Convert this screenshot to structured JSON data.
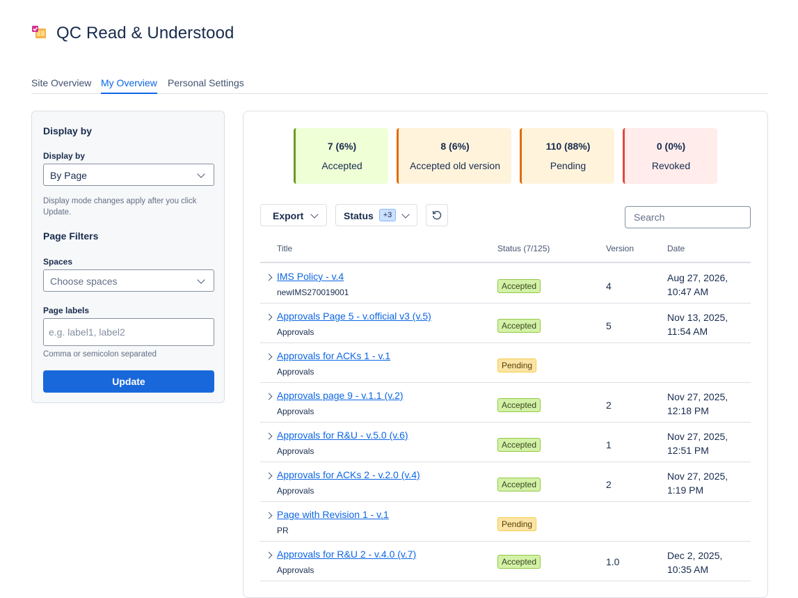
{
  "app": {
    "title": "QC Read & Understood",
    "icon": "book-check-icon"
  },
  "tabs": [
    {
      "label": "Site Overview",
      "active": false
    },
    {
      "label": "My Overview",
      "active": true
    },
    {
      "label": "Personal Settings",
      "active": false
    }
  ],
  "sidebar": {
    "heading": "Display by",
    "display_by": {
      "label": "Display by",
      "value": "By Page",
      "help": "Display mode changes apply after you click Update."
    },
    "page_filters_heading": "Page Filters",
    "spaces": {
      "label": "Spaces",
      "placeholder": "Choose spaces"
    },
    "page_labels": {
      "label": "Page labels",
      "placeholder": "e.g. label1, label2",
      "help": "Comma or semicolon separated"
    },
    "update_label": "Update"
  },
  "stats": [
    {
      "value": "7 (6%)",
      "label": "Accepted",
      "bg": "#efffd6",
      "accent": "#6a9a23"
    },
    {
      "value": "8 (6%)",
      "label": "Accepted old version",
      "bg": "#fff3dc",
      "accent": "#e06c00"
    },
    {
      "value": "110 (88%)",
      "label": "Pending",
      "bg": "#fff3dc",
      "accent": "#e06c00"
    },
    {
      "value": "0 (0%)",
      "label": "Revoked",
      "bg": "#ffeceb",
      "accent": "#e2483d"
    }
  ],
  "toolbar": {
    "export_label": "Export",
    "status_label": "Status",
    "status_count": "+3",
    "search_placeholder": "Search"
  },
  "table": {
    "columns": [
      "Title",
      "Status (7/125)",
      "Version",
      "Date"
    ],
    "rows": [
      {
        "title": "IMS Policy - v.4",
        "space": "newIMS270019001",
        "status": "Accepted",
        "version": "4",
        "date": "Aug 27, 2026,\n10:47 AM"
      },
      {
        "title": "Approvals Page 5 - v.official v3 (v.5)",
        "space": "Approvals",
        "status": "Accepted",
        "version": "5",
        "date": "Nov 13, 2025,\n11:54 AM"
      },
      {
        "title": "Approvals for ACKs 1 - v.1",
        "space": "Approvals",
        "status": "Pending",
        "version": "",
        "date": ""
      },
      {
        "title": "Approvals page 9 - v.1.1 (v.2)",
        "space": "Approvals",
        "status": "Accepted",
        "version": "2",
        "date": "Nov 27, 2025,\n12:18 PM"
      },
      {
        "title": "Approvals for R&U - v.5.0 (v.6)",
        "space": "Approvals",
        "status": "Accepted",
        "version": "1",
        "date": "Nov 27, 2025,\n12:51 PM"
      },
      {
        "title": "Approvals for ACKs 2 - v.2.0 (v.4)",
        "space": "Approvals",
        "status": "Accepted",
        "version": "2",
        "date": "Nov 27, 2025,\n1:19 PM"
      },
      {
        "title": "Page with Revision 1 - v.1",
        "space": "PR",
        "status": "Pending",
        "version": "",
        "date": ""
      },
      {
        "title": "Approvals for R&U 2 - v.4.0 (v.7)",
        "space": "Approvals",
        "status": "Accepted",
        "version": "1.0",
        "date": "Dec 2, 2025,\n10:35 AM"
      }
    ]
  }
}
